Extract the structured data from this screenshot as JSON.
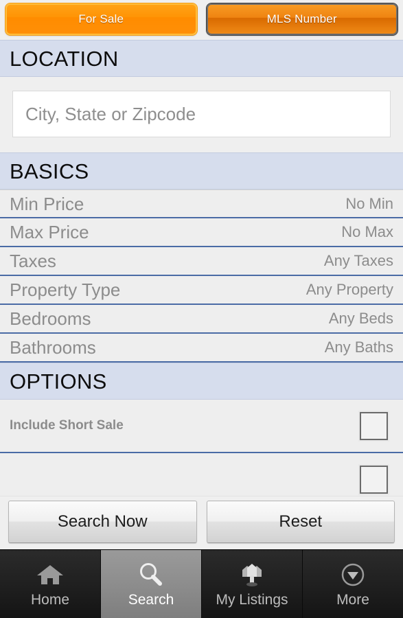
{
  "segmented_tabs": {
    "items": [
      {
        "label": "For Sale",
        "state": "selected"
      },
      {
        "label": "MLS Number",
        "state": "unselected"
      }
    ],
    "selected_color": "#ff8f07",
    "unselected_color": "#ef8411"
  },
  "sections": {
    "location": {
      "header": "LOCATION",
      "search_input": {
        "value": "",
        "placeholder": "City, State or Zipcode"
      }
    },
    "basics": {
      "header": "BASICS",
      "rows": [
        {
          "label": "Min Price",
          "value": "No Min"
        },
        {
          "label": "Max Price",
          "value": "No Max"
        },
        {
          "label": "Taxes",
          "value": "Any Taxes"
        },
        {
          "label": "Property Type",
          "value": "Any Property"
        },
        {
          "label": "Bedrooms",
          "value": "Any Beds"
        },
        {
          "label": "Bathrooms",
          "value": "Any Baths"
        }
      ]
    },
    "options": {
      "header": "OPTIONS",
      "rows": [
        {
          "label": "Include Short Sale",
          "checked": false
        },
        {
          "label": "",
          "checked": false
        }
      ]
    }
  },
  "action_bar": {
    "search_label": "Search Now",
    "reset_label": "Reset"
  },
  "tabbar": {
    "items": [
      {
        "label": "Home",
        "icon": "home-icon",
        "active": false
      },
      {
        "label": "Search",
        "icon": "magnifier-icon",
        "active": true
      },
      {
        "label": "My Listings",
        "icon": "houses-icon",
        "active": false
      },
      {
        "label": "More",
        "icon": "chevron-down-circle-icon",
        "active": false
      }
    ],
    "active_color": "#8d8d8d"
  },
  "theme": {
    "section_header_bg": "#d6dded",
    "row_separator": "#4a6ba5",
    "row_bg": "#eeeeee",
    "page_bg": "#efefef",
    "muted_text": "#8c8c8c"
  }
}
